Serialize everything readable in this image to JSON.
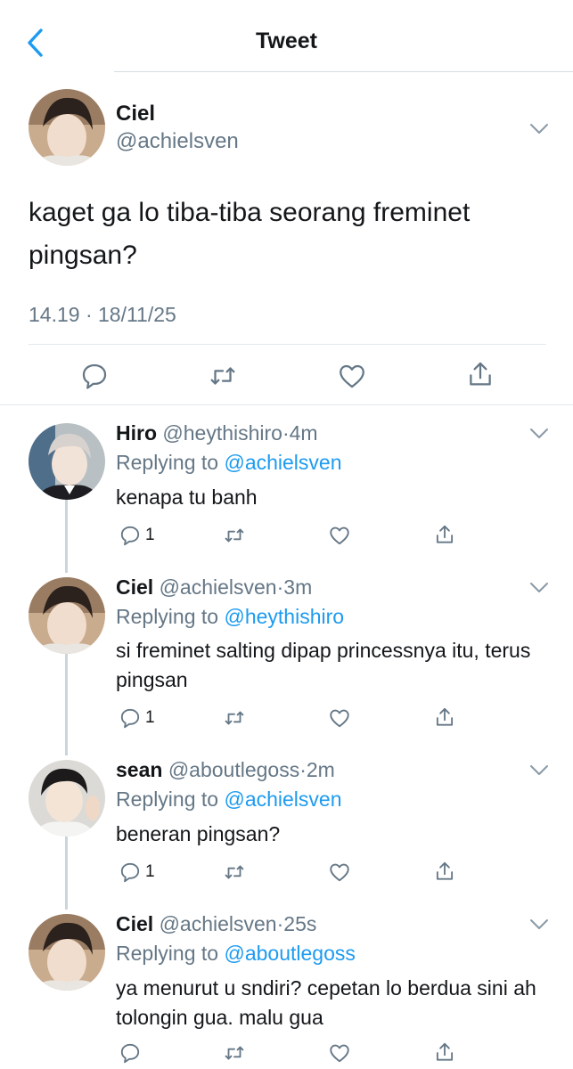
{
  "header": {
    "title": "Tweet"
  },
  "main_tweet": {
    "author_name": "Ciel",
    "author_handle": "@achielsven",
    "text": "kaget ga lo tiba-tiba seorang freminet pingsan?",
    "timestamp": "14.19 · 18/11/25"
  },
  "replies": [
    {
      "name": "Hiro",
      "handle": "@heythishiro",
      "dot": "·",
      "time": "4m",
      "replying_prefix": "Replying to",
      "replying_to": "@achielsven",
      "text": "kenapa tu banh",
      "reply_count": "1"
    },
    {
      "name": "Ciel",
      "handle": "@achielsven",
      "dot": "·",
      "time": "3m",
      "replying_prefix": "Replying to",
      "replying_to": "@heythishiro",
      "text": "si freminet salting dipap princessnya itu, terus pingsan",
      "reply_count": "1"
    },
    {
      "name": "sean",
      "handle": "@aboutlegoss",
      "dot": "·",
      "time": "2m",
      "replying_prefix": "Replying to",
      "replying_to": "@achielsven",
      "text": "beneran pingsan?",
      "reply_count": "1"
    },
    {
      "name": "Ciel",
      "handle": "@achielsven",
      "dot": "·",
      "time": "25s",
      "replying_prefix": "Replying to",
      "replying_to": "@aboutlegoss",
      "text": "ya menurut u sndiri? cepetan lo berdua sini ah tolongin gua. malu gua",
      "reply_count": ""
    }
  ],
  "colors": {
    "accent": "#1d9bf0",
    "text_primary": "#14171a",
    "text_secondary": "#657786",
    "icon_gray": "#657786",
    "thread_line": "#cbd5dc"
  },
  "icons": {
    "back": "chevron-left-icon",
    "more": "chevron-down-icon",
    "reply": "speech-bubble-icon",
    "retweet": "retweet-icon",
    "like": "heart-icon",
    "share": "share-icon"
  }
}
